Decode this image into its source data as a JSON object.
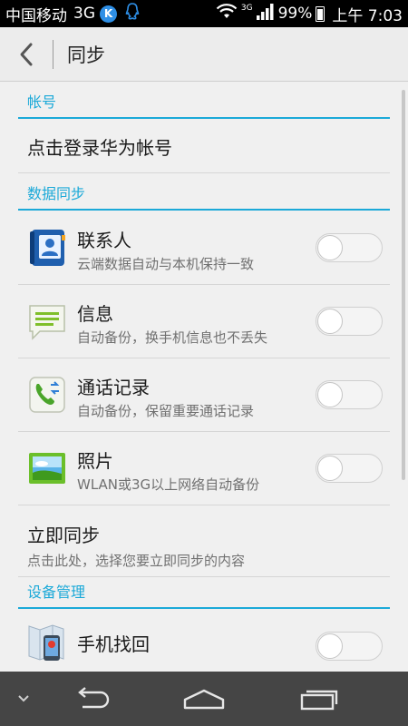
{
  "status_bar": {
    "carrier": "中国移动",
    "network": "3G",
    "badge_letter": "K",
    "signal_type": "3G",
    "battery": "99%",
    "time": "上午 7:03",
    "icons": [
      "k-app-icon",
      "qq-icon",
      "wifi-icon",
      "signal-icon",
      "battery-charging-icon"
    ]
  },
  "action_bar": {
    "title": "同步",
    "back_icon": "chevron-left-icon"
  },
  "sections": {
    "account": {
      "header": "帐号",
      "login_text": "点击登录华为帐号"
    },
    "data_sync": {
      "header": "数据同步",
      "items": [
        {
          "title": "联系人",
          "subtitle": "云端数据自动与本机保持一致",
          "icon": "contacts-icon",
          "enabled": false
        },
        {
          "title": "信息",
          "subtitle": "自动备份，换手机信息也不丢失",
          "icon": "messages-icon",
          "enabled": false
        },
        {
          "title": "通话记录",
          "subtitle": "自动备份，保留重要通话记录",
          "icon": "call-log-icon",
          "enabled": false
        },
        {
          "title": "照片",
          "subtitle": "WLAN或3G以上网络自动备份",
          "icon": "gallery-icon",
          "enabled": false
        }
      ],
      "sync_now": {
        "title": "立即同步",
        "subtitle": "点击此处，选择您要立即同步的内容"
      }
    },
    "device": {
      "header": "设备管理",
      "items": [
        {
          "title": "手机找回",
          "icon": "find-phone-icon",
          "enabled": false
        }
      ]
    }
  },
  "colors": {
    "accent": "#1ba9d8",
    "background": "#f0f0f0",
    "navbar": "#454545"
  },
  "nav_bar": {
    "icons": [
      "chevron-down-icon",
      "back-arrow-icon",
      "home-icon",
      "recents-icon"
    ]
  }
}
